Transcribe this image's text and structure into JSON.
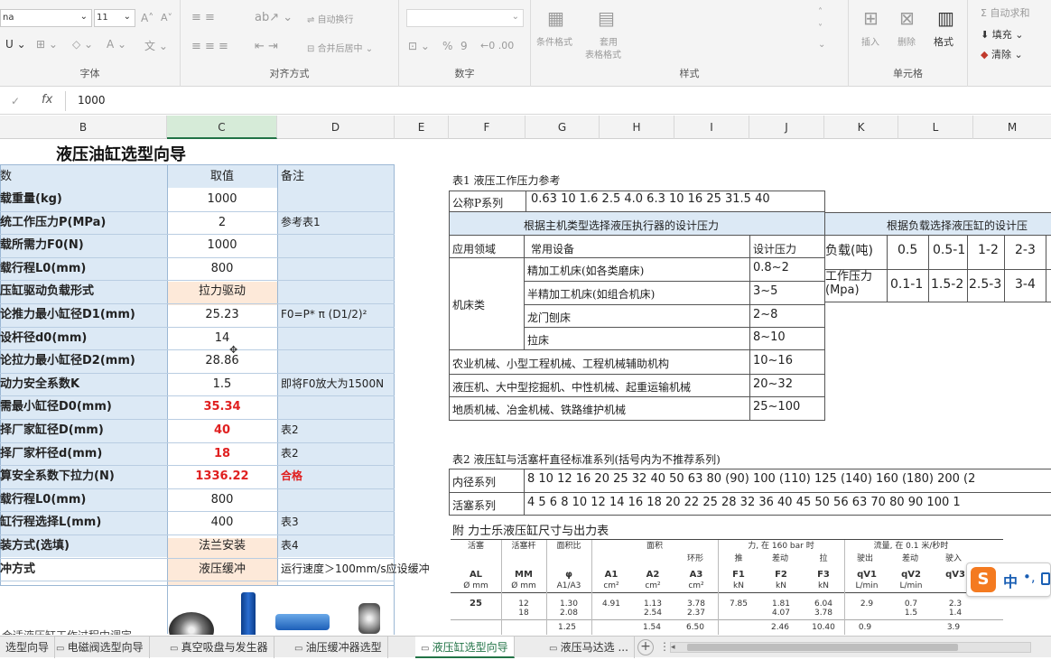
{
  "ribbon": {
    "font_name": "na",
    "font_size": "11",
    "groups": {
      "font": "字体",
      "align": "对齐方式",
      "number": "数字",
      "styles": "样式",
      "cells": "单元格"
    },
    "wrap_text": "自动换行",
    "merge_center": "合并后居中",
    "percent": "%",
    "comma": "9",
    "cond_format": "条件格式",
    "table_format_l1": "套用",
    "table_format_l2": "表格格式",
    "insert": "插入",
    "delete": "删除",
    "format": "格式",
    "autosum": "自动求和",
    "fill": "填充",
    "clear": "清除"
  },
  "formula_bar": {
    "fx": "fx",
    "value": "1000"
  },
  "columns": [
    "B",
    "C",
    "D",
    "E",
    "F",
    "G",
    "H",
    "I",
    "J",
    "K",
    "L",
    "M"
  ],
  "sheet_title": "液压油缸选型向导",
  "left_header": {
    "param": "数",
    "value": "取值",
    "note": "备注"
  },
  "left_rows": [
    {
      "label": "载重量(kg)",
      "value": "1000",
      "note": ""
    },
    {
      "label": "统工作压力P(MPa)",
      "value": "2",
      "note": "参考表1"
    },
    {
      "label": "载所需力F0(N)",
      "value": "1000",
      "note": ""
    },
    {
      "label": "载行程L0(mm)",
      "value": "800",
      "note": ""
    },
    {
      "label": "压缸驱动负载形式",
      "value": "拉力驱动",
      "note": ""
    },
    {
      "label": "论推力最小缸径D1(mm)",
      "value": "25.23",
      "note": "F0=P* π (D1/2)²"
    },
    {
      "label": "设杆径d0(mm)",
      "value": "14",
      "note": ""
    },
    {
      "label": "论拉力最小缸径D2(mm)",
      "value": "28.86",
      "note": ""
    },
    {
      "label": "动力安全系数K",
      "value": "1.5",
      "note": "即将F0放大为1500N"
    },
    {
      "label": "需最小缸径D0(mm)",
      "value": "35.34",
      "note": ""
    },
    {
      "label": "择厂家缸径D(mm)",
      "value": "40",
      "note": "表2"
    },
    {
      "label": "择厂家杆径d(mm)",
      "value": "18",
      "note": "表2"
    },
    {
      "label": "算安全系数下拉力(N)",
      "value": "1336.22",
      "note": "合格"
    },
    {
      "label": "载行程L0(mm)",
      "value": "800",
      "note": ""
    },
    {
      "label": "缸行程选择L(mm)",
      "value": "400",
      "note": "表3"
    },
    {
      "label": "装方式(选填)",
      "value": "法兰安装",
      "note": "表4"
    },
    {
      "label": "冲方式",
      "value": "液压缓冲",
      "note": "运行速度＞100mm/s应设缓冲"
    }
  ],
  "table1": {
    "caption": "表1  液压工作压力参考",
    "series_label": "公称P系列",
    "series_values": "0.63  10  1.6  2.5  4.0  6.3  10  16  25  31.5  40",
    "sub_header": "根据主机类型选择液压执行器的设计压力",
    "col_field": "应用领域",
    "col_equipment": "常用设备",
    "col_pressure": "设计压力",
    "machine_group": "机床类",
    "rows": [
      {
        "field": "",
        "equipment": "精加工机床(如各类磨床)",
        "pressure": "0.8~2"
      },
      {
        "field": "",
        "equipment": "半精加工机床(如组合机床)",
        "pressure": "3~5"
      },
      {
        "field": "",
        "equipment": "龙门刨床",
        "pressure": "2~8"
      },
      {
        "field": "",
        "equipment": "拉床",
        "pressure": "8~10"
      },
      {
        "field": "农业机械、小型工程机械、工程机械辅助机构",
        "equipment": "",
        "pressure": "10~16"
      },
      {
        "field": "液压机、大中型挖掘机、中性机械、起重运输机械",
        "equipment": "",
        "pressure": "20~32"
      },
      {
        "field": "地质机械、冶金机械、铁路维护机械",
        "equipment": "",
        "pressure": "25~100"
      }
    ]
  },
  "load_table": {
    "header": "根据负载选择液压缸的设计压",
    "load_label": "负载(吨)",
    "load_values": [
      "0.5",
      "0.5-1",
      "1-2",
      "2-3"
    ],
    "pressure_label": "工作压力(Mpa)",
    "pressure_values": [
      "0.1-1",
      "1.5-2",
      "2.5-3",
      "3-4"
    ]
  },
  "table2": {
    "caption": "表2  液压缸与活塞杆直径标准系列(括号内为不推荐系列)",
    "bore_label": "内径系列",
    "bore_values": "8  10  12  16  20  25  32  40  50  63  80  (90)  100  (110)   125  (140)  160  (180)  200  (2",
    "rod_label": "活塞系列",
    "rod_values": "4  5  6  8  10  12  14  16  18  20  22  25  28  32  36  40  45  50  56  63  70  80  90  100  1"
  },
  "appendix": {
    "caption": "附  力士乐液压缸尺寸与出力表",
    "h1": [
      "活塞",
      "活塞杆",
      "面积比",
      "面积",
      "力, 在 160 bar 时",
      "流量, 在 0.1 米/秒时"
    ],
    "h2": [
      "活塞",
      "活塞杆",
      "环形",
      "推",
      "差动",
      "拉",
      "驶出",
      "差动",
      "驶入"
    ],
    "h3": [
      "AL",
      "MM",
      "φ",
      "A1",
      "A2",
      "A3",
      "F1",
      "F2",
      "F3",
      "qV1",
      "qV2",
      "qV3"
    ],
    "units": [
      "Ø mm",
      "Ø mm",
      "A1/A3",
      "cm²",
      "cm²",
      "cm²",
      "kN",
      "kN",
      "kN",
      "L/min",
      "L/min",
      ""
    ],
    "row1": [
      "25",
      "12\n18",
      "1.30\n2.08",
      "4.91",
      "1.13\n2.54",
      "3.78\n2.37",
      "7.85",
      "1.81\n4.07",
      "6.04\n3.78",
      "2.9",
      "0.7\n1.5",
      "2.3\n1.4"
    ],
    "row2_partial": [
      "1.25",
      "1.54",
      "6.50",
      "2.46",
      "10.40",
      "0.9",
      "3.9"
    ]
  },
  "bottom_note": "合适液压缸工作过程中调定",
  "ime": {
    "label": "中"
  },
  "sheet_tabs": [
    {
      "label": "选型向导",
      "active": false
    },
    {
      "label": "电磁阀选型向导",
      "active": false
    },
    {
      "label": "真空吸盘与发生器",
      "active": false
    },
    {
      "label": "油压缓冲器选型",
      "active": false
    },
    {
      "label": "液压缸选型向导",
      "active": true
    },
    {
      "label": "液压马达选 ...",
      "active": false
    }
  ],
  "colors": {
    "accent": "#217346",
    "highlight": "#fde9d9",
    "band": "#dce9f5",
    "red": "#e02020"
  }
}
